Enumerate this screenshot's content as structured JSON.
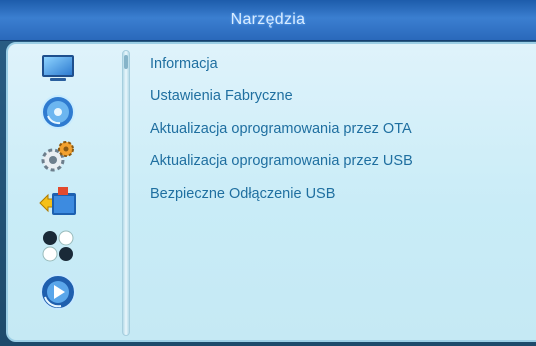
{
  "header": {
    "title": "Narzędzia"
  },
  "sidebar": {
    "icons": [
      {
        "name": "tv-icon",
        "selected": false
      },
      {
        "name": "disc-icon",
        "selected": false
      },
      {
        "name": "gears-icon",
        "selected": false
      },
      {
        "name": "folder-tools-icon",
        "selected": true
      },
      {
        "name": "games-icon",
        "selected": false
      },
      {
        "name": "media-icon",
        "selected": false
      }
    ]
  },
  "menu": {
    "items": [
      "Informacja",
      "Ustawienia Fabryczne",
      "Aktualizacja oprogramowania przez OTA",
      "Aktualizacja oprogramowania przez USB",
      "Bezpieczne Odłączenie USB"
    ]
  }
}
